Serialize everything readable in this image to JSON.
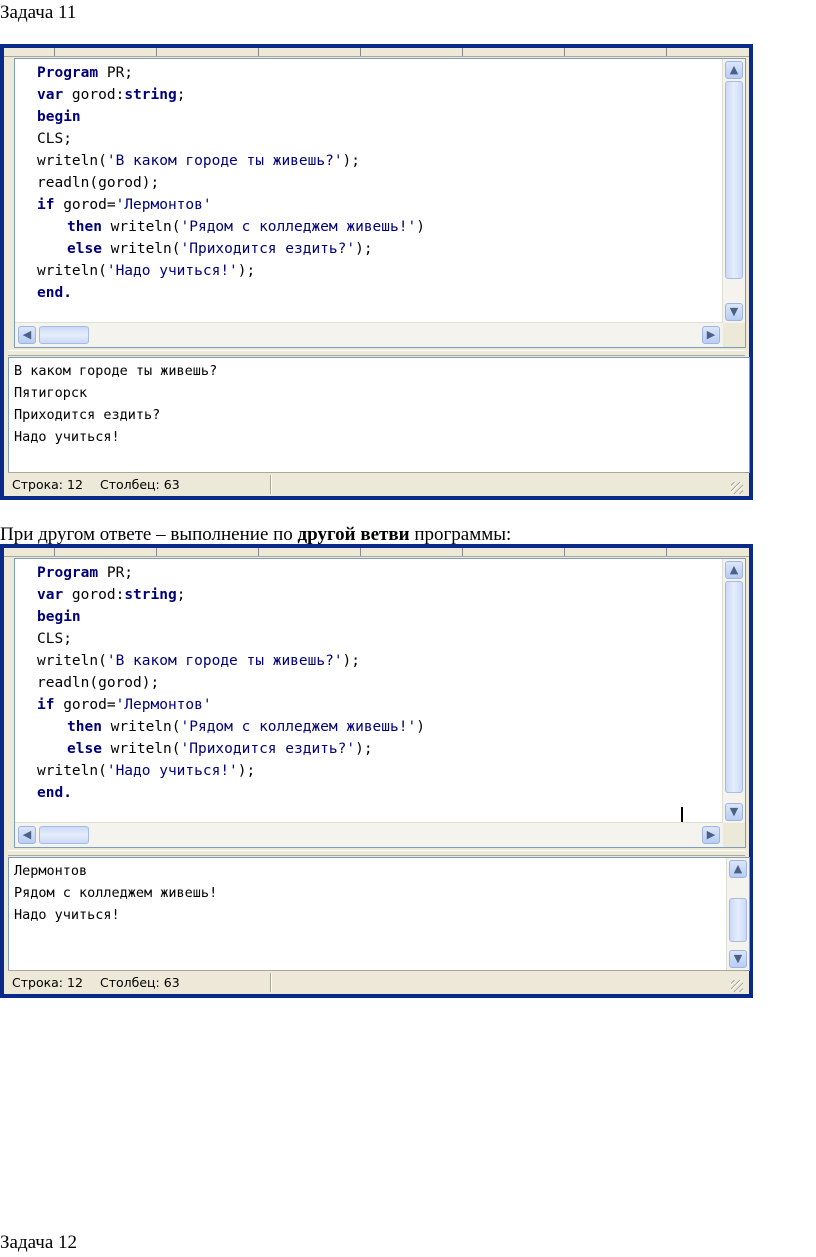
{
  "document": {
    "task11_title": "Задача 11",
    "between_text_before": "При другом ответе – выполнение по ",
    "between_text_bold": "другой ветви",
    "between_text_after": " программы:",
    "task12_title": "Задача 12"
  },
  "code": {
    "line1_kw": "Program",
    "line1_rest": " PR;",
    "line2_kw": "var",
    "line2_mid": " gorod:",
    "line2_kw2": "string",
    "line2_end": ";",
    "line3_kw": "begin",
    "line4": "CLS;",
    "line5_pre": "writeln(",
    "line5_str": "'В каком городе ты живешь?'",
    "line5_post": ");",
    "line6": "readln(gorod);",
    "line7_kw": "if",
    "line7_mid": " gorod=",
    "line7_str": "'Лермонтов'",
    "line8_kw": "then",
    "line8_mid": " writeln(",
    "line8_str": "'Рядом с колледжем живешь!'",
    "line8_post": ")",
    "line9_kw": "else",
    "line9_mid": " writeln(",
    "line9_str": "'Приходится ездить?'",
    "line9_post": ");",
    "line10_pre": "writeln(",
    "line10_str": "'Надо учиться!'",
    "line10_post": ");",
    "line11_kw": "end."
  },
  "window1": {
    "output_lines": [
      "В каком городе ты живешь?",
      "Пятигорск",
      "Приходится ездить?",
      "Надо учиться!"
    ],
    "status_line": "Строка: 12",
    "status_col": "Столбец: 63"
  },
  "window2": {
    "output_lines": [
      "Лермонтов",
      "Рядом с колледжем живешь!",
      "Надо учиться!"
    ],
    "status_line": "Строка: 12",
    "status_col": "Столбец: 63"
  },
  "icons": {
    "scroll_up": "▲",
    "scroll_down": "▼",
    "scroll_left": "◀",
    "scroll_right": "▶"
  },
  "colors": {
    "frame": "#0a2a8a",
    "keyword": "#00007a"
  }
}
